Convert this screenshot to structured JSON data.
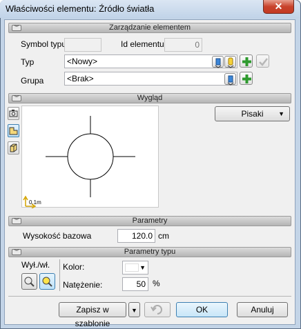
{
  "window": {
    "title": "Właściwości elementu: Źródło światła",
    "close_glyph": "✕"
  },
  "sections": {
    "management": "Zarządzanie elementem",
    "appearance": "Wygląd",
    "parameters": "Parametry",
    "type_parameters": "Parametry typu"
  },
  "management": {
    "symbol_label": "Symbol typu",
    "symbol_value": "",
    "id_label": "Id elementu",
    "id_value": "0",
    "type_label": "Typ",
    "type_value": "<Nowy>",
    "group_label": "Grupa",
    "group_value": "<Brak>"
  },
  "appearance": {
    "pens_button": "Pisaki",
    "scale_label": "0.1m"
  },
  "parameters": {
    "base_height_label": "Wysokość bazowa",
    "base_height_value": "120.0",
    "base_height_unit": "cm"
  },
  "type_params": {
    "toggle_label": "Wył./wł.",
    "color_label": "Kolor:",
    "intensity_label": "Natężenie:",
    "intensity_value": "50",
    "intensity_unit": "%"
  },
  "footer": {
    "save_template": "Zapisz w szablonie",
    "ok": "OK",
    "cancel": "Anuluj"
  },
  "colors": {
    "accent_green": "#2e9a2e",
    "section_bg": "#c8c8c8"
  }
}
